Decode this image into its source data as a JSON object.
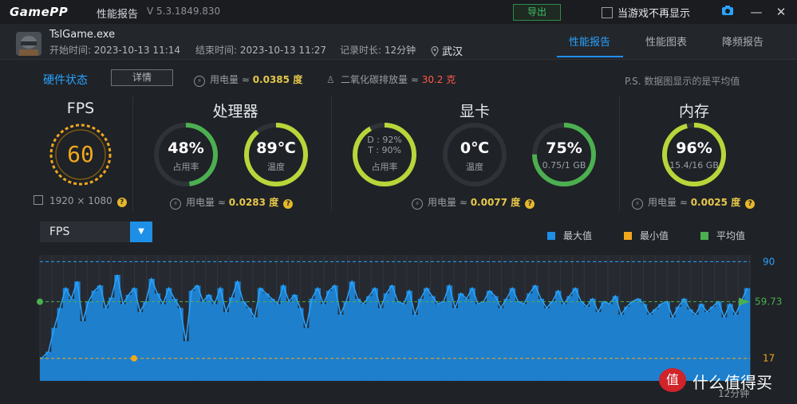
{
  "titlebar": {
    "logo": "GamePP",
    "title": "性能报告",
    "version": "V 5.3.1849.830",
    "export_label": "导出",
    "no_show_label": "当游戏不再显示",
    "camera_icon": "camera-icon",
    "minimize_icon": "minimize-icon",
    "close_icon": "close-icon"
  },
  "info": {
    "process": "TslGame.exe",
    "start_label": "开始时间:",
    "start_time": "2023-10-13 11:14",
    "end_label": "结束时间:",
    "end_time": "2023-10-13 11:27",
    "duration_label": "记录时长:",
    "duration": "12分钟",
    "location": "武汉"
  },
  "tabs": [
    "性能报告",
    "性能图表",
    "降频报告"
  ],
  "hardware": {
    "title": "硬件状态",
    "detail_button": "详情",
    "power_label": "用电量 ≈",
    "power_value": "0.0385 度",
    "co2_label": "二氧化碳排放量 ≈",
    "co2_value": "30.2 克",
    "note": "P.S. 数据图显示的是平均值"
  },
  "sections": {
    "fps": {
      "title": "FPS",
      "value": "60",
      "resolution": "1920 × 1080"
    },
    "cpu": {
      "title": "处理器",
      "usage_value": "48%",
      "usage_label": "占用率",
      "usage_fraction": 0.48,
      "temp_value": "89℃",
      "temp_label": "温度",
      "temp_fraction": 0.89,
      "power_label": "用电量 ≈",
      "power_value": "0.0283 度"
    },
    "gpu": {
      "title": "显卡",
      "usage_d": "D : 92%",
      "usage_t": "T : 90%",
      "usage_label": "占用率",
      "usage_fraction": 0.92,
      "temp_value": "0℃",
      "temp_label": "温度",
      "temp_fraction": 0,
      "vram_value": "75%",
      "vram_label": "0.75/1 GB",
      "vram_fraction": 0.75,
      "power_label": "用电量 ≈",
      "power_value": "0.0077 度"
    },
    "mem": {
      "title": "内存",
      "usage_value": "96%",
      "usage_label": "15.4/16 GB",
      "usage_fraction": 0.96,
      "power_label": "用电量 ≈",
      "power_value": "0.0025 度"
    }
  },
  "chart_controls": {
    "metric": "FPS",
    "legend": [
      {
        "label": "最大值",
        "color": "#1e8fe6"
      },
      {
        "label": "最小值",
        "color": "#f0a81c"
      },
      {
        "label": "平均值",
        "color": "#4caf50"
      }
    ]
  },
  "chart_data": {
    "type": "area",
    "series": [
      {
        "name": "FPS",
        "values": [
          18,
          22,
          40,
          55,
          70,
          62,
          75,
          45,
          60,
          68,
          72,
          55,
          63,
          80,
          58,
          65,
          70,
          52,
          60,
          77,
          66,
          58,
          70,
          62,
          55,
          30,
          68,
          72,
          60,
          65,
          58,
          70,
          52,
          63,
          75,
          60,
          55,
          48,
          70,
          66,
          62,
          58,
          72,
          60,
          65,
          55,
          40,
          62,
          70,
          58,
          68,
          72,
          50,
          60,
          75,
          62,
          58,
          64,
          70,
          55,
          66,
          72,
          60,
          58,
          68,
          50,
          62,
          70,
          64,
          58,
          60,
          72,
          55,
          66,
          62,
          70,
          58,
          60,
          68,
          64,
          55,
          62,
          70,
          60,
          58,
          66,
          72,
          62,
          55,
          60,
          68,
          58,
          64,
          70,
          60,
          56,
          62,
          52,
          60,
          58,
          64,
          50,
          56,
          60,
          62,
          58,
          50,
          54,
          58,
          60,
          48,
          56,
          62,
          54,
          50,
          58,
          52,
          56,
          60,
          48,
          58,
          50,
          60,
          70
        ]
      }
    ],
    "max": 90,
    "min": 17,
    "avg": 59.73,
    "y_labels": [
      "90",
      "59.73",
      "17"
    ],
    "x_label": "12分钟",
    "ylim": [
      0,
      95
    ]
  },
  "watermark": {
    "logo": "值",
    "text": "什么值得买"
  }
}
